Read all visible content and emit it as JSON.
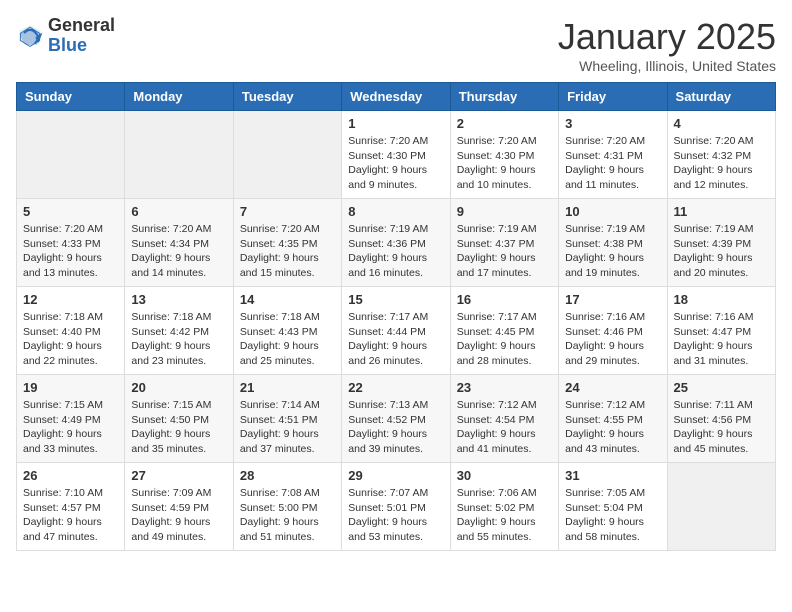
{
  "header": {
    "logo_general": "General",
    "logo_blue": "Blue",
    "month_title": "January 2025",
    "location": "Wheeling, Illinois, United States"
  },
  "weekdays": [
    "Sunday",
    "Monday",
    "Tuesday",
    "Wednesday",
    "Thursday",
    "Friday",
    "Saturday"
  ],
  "weeks": [
    [
      {
        "day": null,
        "info": null
      },
      {
        "day": null,
        "info": null
      },
      {
        "day": null,
        "info": null
      },
      {
        "day": "1",
        "info": "Sunrise: 7:20 AM\nSunset: 4:30 PM\nDaylight: 9 hours\nand 9 minutes."
      },
      {
        "day": "2",
        "info": "Sunrise: 7:20 AM\nSunset: 4:30 PM\nDaylight: 9 hours\nand 10 minutes."
      },
      {
        "day": "3",
        "info": "Sunrise: 7:20 AM\nSunset: 4:31 PM\nDaylight: 9 hours\nand 11 minutes."
      },
      {
        "day": "4",
        "info": "Sunrise: 7:20 AM\nSunset: 4:32 PM\nDaylight: 9 hours\nand 12 minutes."
      }
    ],
    [
      {
        "day": "5",
        "info": "Sunrise: 7:20 AM\nSunset: 4:33 PM\nDaylight: 9 hours\nand 13 minutes."
      },
      {
        "day": "6",
        "info": "Sunrise: 7:20 AM\nSunset: 4:34 PM\nDaylight: 9 hours\nand 14 minutes."
      },
      {
        "day": "7",
        "info": "Sunrise: 7:20 AM\nSunset: 4:35 PM\nDaylight: 9 hours\nand 15 minutes."
      },
      {
        "day": "8",
        "info": "Sunrise: 7:19 AM\nSunset: 4:36 PM\nDaylight: 9 hours\nand 16 minutes."
      },
      {
        "day": "9",
        "info": "Sunrise: 7:19 AM\nSunset: 4:37 PM\nDaylight: 9 hours\nand 17 minutes."
      },
      {
        "day": "10",
        "info": "Sunrise: 7:19 AM\nSunset: 4:38 PM\nDaylight: 9 hours\nand 19 minutes."
      },
      {
        "day": "11",
        "info": "Sunrise: 7:19 AM\nSunset: 4:39 PM\nDaylight: 9 hours\nand 20 minutes."
      }
    ],
    [
      {
        "day": "12",
        "info": "Sunrise: 7:18 AM\nSunset: 4:40 PM\nDaylight: 9 hours\nand 22 minutes."
      },
      {
        "day": "13",
        "info": "Sunrise: 7:18 AM\nSunset: 4:42 PM\nDaylight: 9 hours\nand 23 minutes."
      },
      {
        "day": "14",
        "info": "Sunrise: 7:18 AM\nSunset: 4:43 PM\nDaylight: 9 hours\nand 25 minutes."
      },
      {
        "day": "15",
        "info": "Sunrise: 7:17 AM\nSunset: 4:44 PM\nDaylight: 9 hours\nand 26 minutes."
      },
      {
        "day": "16",
        "info": "Sunrise: 7:17 AM\nSunset: 4:45 PM\nDaylight: 9 hours\nand 28 minutes."
      },
      {
        "day": "17",
        "info": "Sunrise: 7:16 AM\nSunset: 4:46 PM\nDaylight: 9 hours\nand 29 minutes."
      },
      {
        "day": "18",
        "info": "Sunrise: 7:16 AM\nSunset: 4:47 PM\nDaylight: 9 hours\nand 31 minutes."
      }
    ],
    [
      {
        "day": "19",
        "info": "Sunrise: 7:15 AM\nSunset: 4:49 PM\nDaylight: 9 hours\nand 33 minutes."
      },
      {
        "day": "20",
        "info": "Sunrise: 7:15 AM\nSunset: 4:50 PM\nDaylight: 9 hours\nand 35 minutes."
      },
      {
        "day": "21",
        "info": "Sunrise: 7:14 AM\nSunset: 4:51 PM\nDaylight: 9 hours\nand 37 minutes."
      },
      {
        "day": "22",
        "info": "Sunrise: 7:13 AM\nSunset: 4:52 PM\nDaylight: 9 hours\nand 39 minutes."
      },
      {
        "day": "23",
        "info": "Sunrise: 7:12 AM\nSunset: 4:54 PM\nDaylight: 9 hours\nand 41 minutes."
      },
      {
        "day": "24",
        "info": "Sunrise: 7:12 AM\nSunset: 4:55 PM\nDaylight: 9 hours\nand 43 minutes."
      },
      {
        "day": "25",
        "info": "Sunrise: 7:11 AM\nSunset: 4:56 PM\nDaylight: 9 hours\nand 45 minutes."
      }
    ],
    [
      {
        "day": "26",
        "info": "Sunrise: 7:10 AM\nSunset: 4:57 PM\nDaylight: 9 hours\nand 47 minutes."
      },
      {
        "day": "27",
        "info": "Sunrise: 7:09 AM\nSunset: 4:59 PM\nDaylight: 9 hours\nand 49 minutes."
      },
      {
        "day": "28",
        "info": "Sunrise: 7:08 AM\nSunset: 5:00 PM\nDaylight: 9 hours\nand 51 minutes."
      },
      {
        "day": "29",
        "info": "Sunrise: 7:07 AM\nSunset: 5:01 PM\nDaylight: 9 hours\nand 53 minutes."
      },
      {
        "day": "30",
        "info": "Sunrise: 7:06 AM\nSunset: 5:02 PM\nDaylight: 9 hours\nand 55 minutes."
      },
      {
        "day": "31",
        "info": "Sunrise: 7:05 AM\nSunset: 5:04 PM\nDaylight: 9 hours\nand 58 minutes."
      },
      {
        "day": null,
        "info": null
      }
    ]
  ]
}
